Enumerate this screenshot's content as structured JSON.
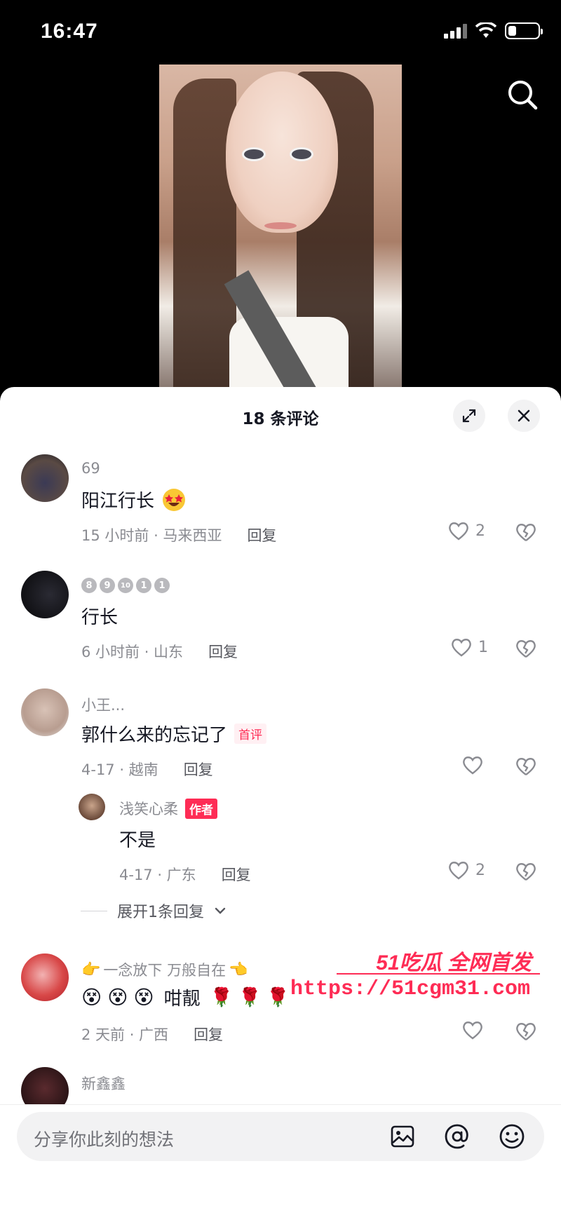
{
  "status": {
    "time": "16:47"
  },
  "sheet": {
    "title": "18 条评论"
  },
  "comments": [
    {
      "user": "69",
      "text": "阳江行长",
      "emoji": "star-struck",
      "time_loc": "15 小时前 · 马来西亚",
      "reply": "回复",
      "likes": "2"
    },
    {
      "badges": [
        "8",
        "9",
        "10",
        "1",
        "1"
      ],
      "text": "行长",
      "time_loc": "6 小时前 · 山东",
      "reply": "回复",
      "likes": "1"
    },
    {
      "user": "小王...",
      "text": "郭什么来的忘记了",
      "tag": "首评",
      "time_loc": "4-17 · 越南",
      "reply": "回复",
      "likes": ""
    },
    {
      "user": "一念放下 万般自在",
      "text": "咁靓",
      "time_loc": "2 天前 · 广西",
      "reply": "回复",
      "likes": ""
    },
    {
      "user": "新鑫鑫"
    }
  ],
  "author_reply": {
    "user": "浅笑心柔",
    "tag": "作者",
    "text": "不是",
    "time_loc": "4-17 · 广东",
    "reply": "回复",
    "likes": "2"
  },
  "expand_replies": "展开1条回复",
  "watermark": {
    "title": "51吃瓜 全网首发",
    "url": "https://51cgm31.com"
  },
  "input": {
    "placeholder": "分享你此刻的想法"
  }
}
